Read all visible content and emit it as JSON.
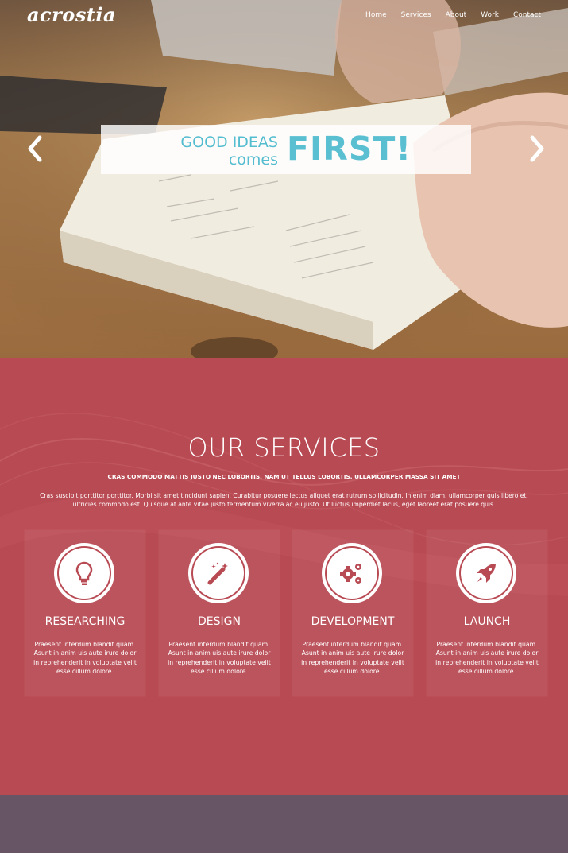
{
  "header": {
    "logo": "acrostia",
    "nav": [
      "Home",
      "Services",
      "About",
      "Work",
      "Contact"
    ]
  },
  "hero": {
    "line1": "GOOD IDEAS",
    "line2": "comes",
    "headline": "FIRST!"
  },
  "services": {
    "title": "OUR SERVICES",
    "subtitle": "CRAS COMMODO MATTIS JUSTO NEC LOBORTIS. NAM UT TELLUS LOBORTIS, ULLAMCORPER MASSA SIT AMET",
    "body": "Cras suscipit porttitor porttitor. Morbi sit amet tincidunt sapien. Curabitur posuere lectus aliquet erat rutrum sollicitudin. In enim diam, ullamcorper quis libero et, ultricies commodo est. Quisque at ante vitae justo fermentum viverra ac eu justo. Ut luctus imperdiet lacus, eget laoreet erat posuere quis.",
    "cards": [
      {
        "title": "RESEARCHING",
        "icon": "lightbulb-icon",
        "text": "Praesent interdum blandit quam. Asunt in anim uis aute irure dolor in reprehenderit in voluptate velit esse cillum dolore."
      },
      {
        "title": "DESIGN",
        "icon": "magic-wand-icon",
        "text": "Praesent interdum blandit quam. Asunt in anim uis aute irure dolor in reprehenderit in voluptate velit esse cillum dolore."
      },
      {
        "title": "DEVELOPMENT",
        "icon": "gears-icon",
        "text": "Praesent interdum blandit quam. Asunt in anim uis aute irure dolor in reprehenderit in voluptate velit esse cillum dolore."
      },
      {
        "title": "LAUNCH",
        "icon": "rocket-icon",
        "text": "Praesent interdum blandit quam. Asunt in anim uis aute irure dolor in reprehenderit in voluptate velit esse cillum dolore."
      }
    ]
  },
  "colors": {
    "accent": "#5bbfd2",
    "services_bg": "#b84a53",
    "footer_bg": "#675566"
  }
}
